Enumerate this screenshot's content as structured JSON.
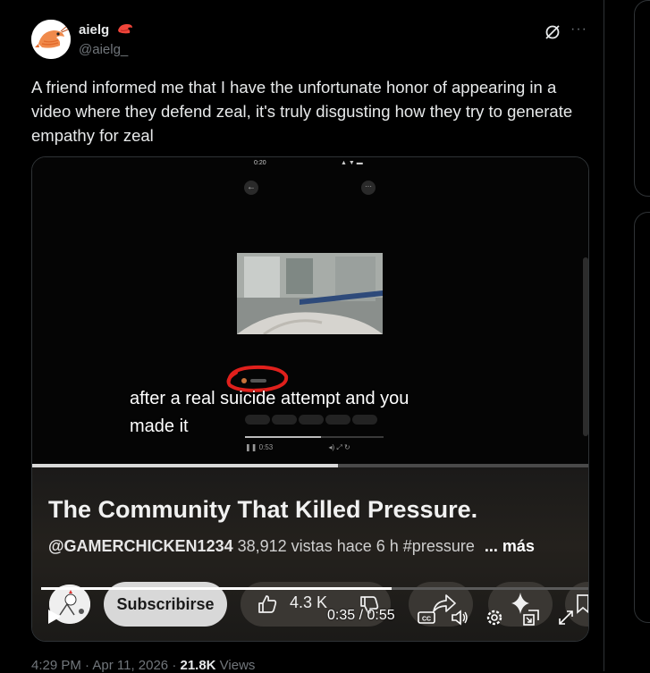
{
  "tweet": {
    "display_name": "aielg",
    "handle": "@aielg_",
    "text": "A friend informed me that I have the unfortunate honor of appearing in a video where they defend zeal, it's truly disgusting how they try to generate empathy for zeal",
    "timestamp": "4:29 PM · Apr 11, 2026 · ",
    "views_count": "21.8K",
    "views_label": " Views"
  },
  "media": {
    "phone_status_time": "0:20",
    "caption_line1": "after a real suicide attempt and you",
    "caption_line2": "made it",
    "phone_elapsed": "0:53",
    "embedded_progress": 0.55,
    "video": {
      "title": "The Community That Killed Pressure.",
      "channel": "@GAMERCHICKEN1234",
      "views": "38,912 vistas",
      "age": "hace 6 h",
      "hashtag": "#pressure",
      "more": "... más",
      "subscribe_label": "Subscribirse",
      "like_count": "4.3 K",
      "time_display": "0:35 / 0:55",
      "progress": 0.64
    }
  },
  "colors": {
    "background": "#000000",
    "text_primary": "#e7e9ea",
    "text_secondary": "#71767b",
    "border": "#2f3336",
    "scribble_red": "#e0201c"
  },
  "icons": [
    "grok-icon",
    "more-icon",
    "play-icon",
    "like-icon",
    "dislike-icon",
    "share-icon",
    "remix-icon",
    "save-icon",
    "cc-icon",
    "volume-icon",
    "settings-icon",
    "miniplayer-icon",
    "fullscreen-icon"
  ]
}
